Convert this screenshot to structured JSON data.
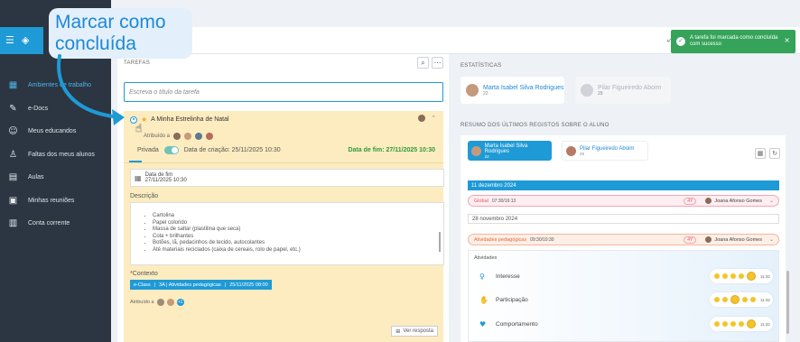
{
  "callout": {
    "text": "Marcar como concluída"
  },
  "sidebar": {
    "items": [
      {
        "label": "Ambientes de trabalho",
        "icon": "grid-icon",
        "glyph": "▦"
      },
      {
        "label": "e-Docs",
        "icon": "document-edit-icon",
        "glyph": "✎"
      },
      {
        "label": "Meus educandos",
        "icon": "child-icon",
        "glyph": "☺"
      },
      {
        "label": "Faltas dos meus alunos",
        "icon": "person-absence-icon",
        "glyph": "♙"
      },
      {
        "label": "Aulas",
        "icon": "book-icon",
        "glyph": "▤"
      },
      {
        "label": "Minhas reuniões",
        "icon": "meeting-icon",
        "glyph": "▣"
      },
      {
        "label": "Conta corrente",
        "icon": "wallet-icon",
        "glyph": "▥"
      }
    ]
  },
  "toast": {
    "message": "A tarefa foi marcada como concluída com sucesso",
    "close": "×",
    "check": "✓"
  },
  "tasks": {
    "title": "TAREFAS",
    "input_placeholder": "Escreva o título da tarefa",
    "task": {
      "title": "A Minha Estrelinha de Natal",
      "assigned_label": "Atribuído a",
      "visibility": "Privada",
      "created": "Data de criação: 25/11/2025 10:30",
      "end": "Data de fim: 27/11/2025 10:30",
      "due_label": "Data de fim",
      "due_value": "27/11/2025 10:30",
      "description_label": "Descrição",
      "materials": [
        "Cartolina",
        "Papel colorido",
        "Massa de saltar (plastilina que seca)",
        "Cola + brilhantes",
        "Botões, lã, pedacinhos de tecido, autocolantes",
        "Até materiais reciclados (caixa de cereais, rolo de papel, etc.)"
      ],
      "context_label": "*Contexto",
      "context": [
        "e-Class",
        "|",
        "3A | Atividades pedagógicas",
        "|",
        "25/11/2025 08:00"
      ],
      "assigned2_label": "Atribuído a",
      "plus": "+1",
      "reply_button": "Ver resposta"
    }
  },
  "stats": {
    "title": "ESTATÍSTICAS",
    "cards": [
      {
        "name": "Marta Isabel Silva Rodrigues",
        "count": "22"
      },
      {
        "name": "Pilar Figueiredo Aboim",
        "count": "29"
      }
    ]
  },
  "summary": {
    "title": "RESUMO DOS ÚLTIMOS REGISTOS SOBRE O ALUNO",
    "chips": [
      {
        "name": "Marta Isabel Silva Rodrigues",
        "count": "22"
      },
      {
        "name": "Pilar Figueiredo Aboim",
        "count": "29"
      }
    ],
    "date1": "11 dezembro 2024",
    "entry1": {
      "label": "Global",
      "time": "07:30/16:13",
      "badge": "4Y",
      "who": "Joana Afonso Gomes"
    },
    "date2": "28 novembro 2024",
    "entry2": {
      "label": "Atividades pedagógicas",
      "time": "09:30/10:30",
      "badge": "4Y",
      "who": "Joana Afonso Gomes"
    },
    "activities_title": "Atividades",
    "activities": [
      {
        "label": "Interesse",
        "time": "11:32"
      },
      {
        "label": "Participação",
        "time": "11:32"
      },
      {
        "label": "Comportamento",
        "time": "11:32"
      }
    ]
  }
}
